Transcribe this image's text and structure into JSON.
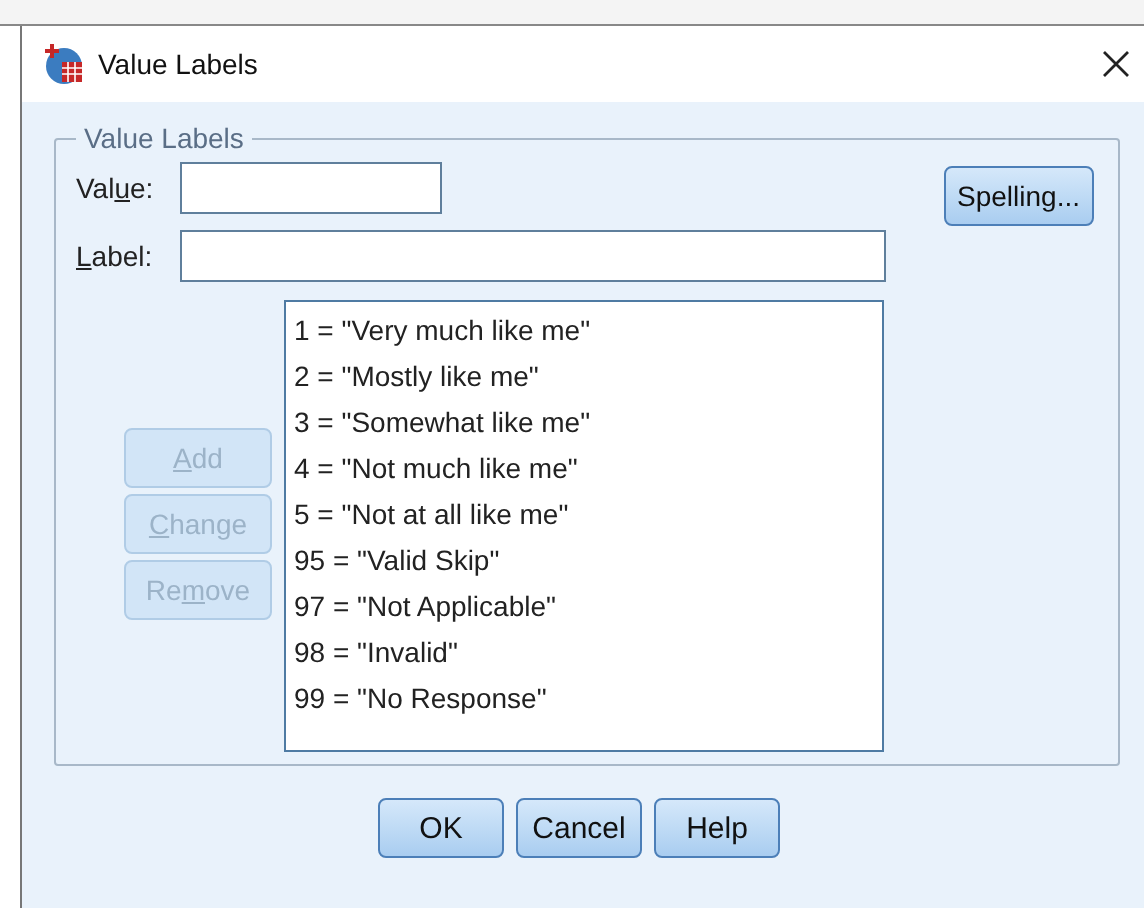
{
  "window": {
    "title": "Value Labels"
  },
  "group": {
    "title": "Value Labels"
  },
  "value_field": {
    "label": {
      "before": "Val",
      "key": "u",
      "after": "e:"
    }
  },
  "label_field": {
    "label": {
      "key": "L",
      "after": "abel:"
    }
  },
  "spelling_button": {
    "label": "Spelling...",
    "disabled": false
  },
  "side_buttons": [
    {
      "label": {
        "key": "A",
        "after": "dd"
      },
      "disabled": true
    },
    {
      "label": {
        "key": "C",
        "after": "hange"
      },
      "disabled": true
    },
    {
      "label": {
        "before": "Re",
        "key": "m",
        "after": "ove"
      },
      "disabled": true
    }
  ],
  "labels_list": [
    {
      "text": "1 = \"Very much like me\"",
      "selected": false
    },
    {
      "text": "2 = \"Mostly like me\"",
      "selected": false
    },
    {
      "text": "3 = \"Somewhat like me\"",
      "selected": false
    },
    {
      "text": "4 = \"Not much like me\"",
      "selected": false
    },
    {
      "text": "5 = \"Not at all like me\"",
      "selected": false
    },
    {
      "text": "95 = \"Valid Skip\"",
      "selected": false
    },
    {
      "text": "97 = \"Not Applicable\"",
      "selected": false
    },
    {
      "text": "98 = \"Invalid\"",
      "selected": false
    },
    {
      "text": "99 = \"No Response\"",
      "selected": false
    }
  ],
  "buttons": [
    {
      "label": "OK"
    },
    {
      "label": "Cancel"
    },
    {
      "label": "Help"
    }
  ]
}
